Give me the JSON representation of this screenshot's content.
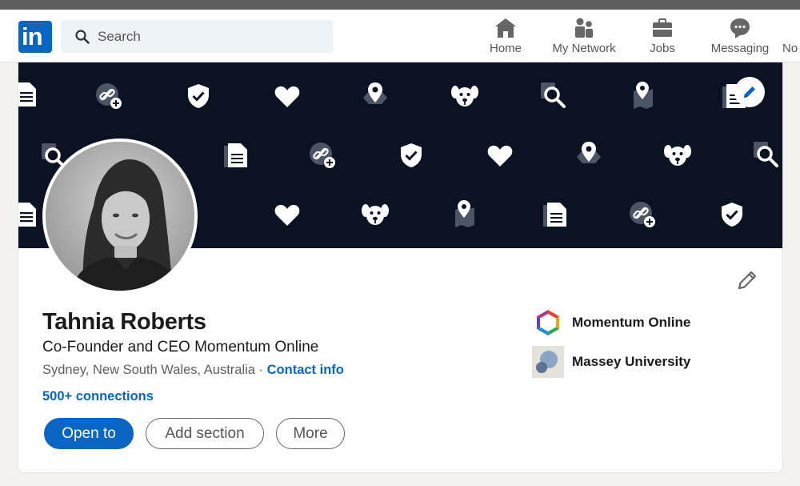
{
  "nav": {
    "search_placeholder": "Search",
    "items": [
      {
        "label": "Home",
        "icon": "home-icon"
      },
      {
        "label": "My Network",
        "icon": "network-icon"
      },
      {
        "label": "Jobs",
        "icon": "briefcase-icon"
      },
      {
        "label": "Messaging",
        "icon": "messaging-icon"
      },
      {
        "label": "No",
        "icon": "notifications-icon"
      }
    ]
  },
  "profile": {
    "name": "Tahnia Roberts",
    "headline": "Co-Founder and CEO Momentum Online",
    "location": "Sydney, New South Wales, Australia",
    "separator": " · ",
    "contact_label": "Contact info",
    "connections": "500+ connections"
  },
  "actions": {
    "open_to": "Open to",
    "add_section": "Add section",
    "more": "More"
  },
  "organizations": [
    {
      "name": "Momentum Online",
      "icon": "momentum-logo"
    },
    {
      "name": "Massey University",
      "icon": "massey-logo"
    }
  ],
  "colors": {
    "brand": "#0a66c2",
    "banner": "#0b1323"
  }
}
